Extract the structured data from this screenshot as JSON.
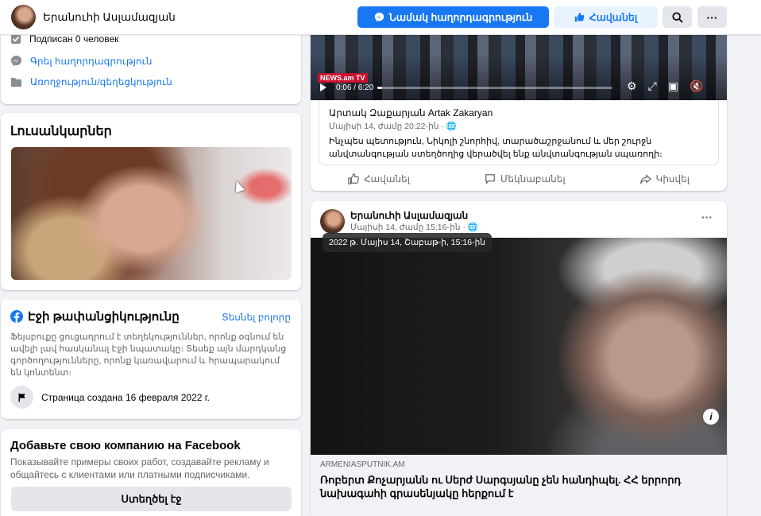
{
  "header": {
    "page_name": "Երանուհի Ասլամազյան",
    "message_button": "Նամակ հաղորդագրություն",
    "like_button": "Հավանել",
    "more_label": "···"
  },
  "intro": {
    "subscribed": "Подписан 0 человек",
    "send_message": "Գրել հաղորդագրություն",
    "category": "Առողջություն/գեղեցկություն"
  },
  "photos": {
    "title": "Լուսանկարներ"
  },
  "transparency": {
    "title": "Էջի թափանցիկությունը",
    "see_all": "Տեսնել բոլորը",
    "text": "Ֆեյսբուքը ցուցադրում է տեղեկություններ, որոնք օգնում են ավելի լավ հասկանալ Էջի նպատակը։ Տեսեք այն մարդկանց գործողությունները, որոնք կառավարում և հրապարակում են կոնտենտ։",
    "created": "Страница создана 16 февраля 2022 г."
  },
  "business": {
    "title": "Добавьте свою компанию на Facebook",
    "text": "Показывайте примеры своих работ, создавайте рекламу и общайтесь с клиентами или платными подписчиками.",
    "button": "Ստեղծել էջ"
  },
  "post1": {
    "video_logo": "NEWS.am TV",
    "video_time": "0:06 / 6:20",
    "video_progress": 0.02,
    "shared_author_hy": "Արտակ Զաքարյան",
    "shared_author_en": "Artak Zakaryan",
    "shared_date": "Մայիսի 14, ժամը 20:22֊ին · ",
    "shared_text": "Ինչպես պետություն, Նիկոլի շնորհիվ, տարածաշրջանում և մեր շուրջն անվտանգության ստեղծողից վերածվել ենք անվտանգության սպառողի։",
    "like": "Հավանել",
    "comment": "Մեկնաբանել",
    "share": "Կիսվել"
  },
  "post2": {
    "author": "Երանուհի Ասլամազյան",
    "date": "Մայիսի 14, ժամը 15:16֊ին · ",
    "tooltip": "2022 թ. Մայիս 14, Շաբաթ-ի, 15:16-ին",
    "more_label": "···",
    "link_domain": "ARMENIASPUTNIK.AM",
    "link_title": "Ռոբերտ Քոչարյանն ու Սերժ Սարգսյանը չեն հանդիպել. ՀՀ երրորդ նախագահի գրասենյակը հերքում է"
  }
}
